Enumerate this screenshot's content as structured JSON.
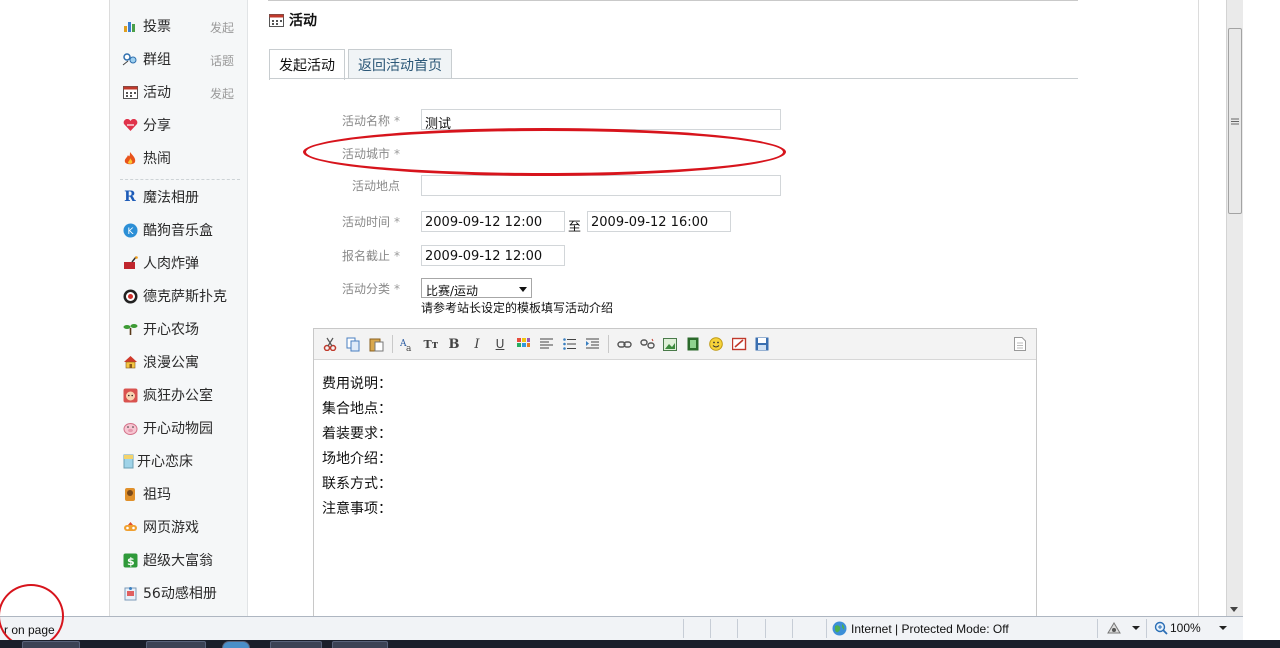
{
  "sidebar": {
    "items": [
      {
        "label": "投票",
        "action": "发起",
        "icon": "poll-icon"
      },
      {
        "label": "群组",
        "action": "话题",
        "icon": "group-icon"
      },
      {
        "label": "活动",
        "action": "发起",
        "icon": "event-icon"
      },
      {
        "label": "分享",
        "action": "",
        "icon": "share-heart-icon"
      },
      {
        "label": "热闹",
        "action": "",
        "icon": "fire-icon"
      },
      {
        "label": "魔法相册",
        "action": "",
        "icon": "magic-album-icon"
      },
      {
        "label": "酷狗音乐盒",
        "action": "",
        "icon": "kugou-music-icon"
      },
      {
        "label": "人肉炸弹",
        "action": "",
        "icon": "bomb-icon"
      },
      {
        "label": "德克萨斯扑克",
        "action": "",
        "icon": "poker-chip-icon"
      },
      {
        "label": "开心农场",
        "action": "",
        "icon": "farm-sprout-icon"
      },
      {
        "label": "浪漫公寓",
        "action": "",
        "icon": "house-icon"
      },
      {
        "label": "疯狂办公室",
        "action": "",
        "icon": "office-face-icon"
      },
      {
        "label": "开心动物园",
        "action": "",
        "icon": "pig-icon"
      },
      {
        "label": "开心恋床",
        "action": "",
        "icon": "bed-icon"
      },
      {
        "label": "祖玛",
        "action": "",
        "icon": "zuma-icon"
      },
      {
        "label": "网页游戏",
        "action": "",
        "icon": "web-game-icon"
      },
      {
        "label": "超级大富翁",
        "action": "",
        "icon": "money-icon"
      },
      {
        "label": "56动感相册",
        "action": "",
        "icon": "photo-album-icon"
      }
    ]
  },
  "page": {
    "title": "活动",
    "tabs": [
      "发起活动",
      "返回活动首页"
    ]
  },
  "form": {
    "name_label": "活动名称",
    "name_value": "测试",
    "city_label": "活动城市",
    "location_label": "活动地点",
    "location_value": "",
    "time_label": "活动时间",
    "time_start": "2009-09-12 12:00",
    "time_to": "至",
    "time_end": "2009-09-12 16:00",
    "deadline_label": "报名截止",
    "deadline_value": "2009-09-12 12:00",
    "category_label": "活动分类",
    "category_value": "比赛/运动",
    "required_mark": "*",
    "hint": "请参考站长设定的模板填写活动介绍"
  },
  "editor": {
    "toolbar_icons": [
      "cut-icon",
      "copy-icon",
      "paste-icon",
      "font-icon",
      "font-size-icon",
      "bold-icon",
      "italic-icon",
      "underline-icon",
      "color-icon",
      "align-icon",
      "list-icon",
      "indent-icon",
      "link-icon",
      "unlink-icon",
      "image-icon",
      "media-icon",
      "smiley-icon",
      "clear-format-icon",
      "save-icon",
      "source-icon"
    ],
    "lines": [
      "费用说明：",
      "集合地点：",
      "着装要求：",
      "场地介绍：",
      "联系方式：",
      "注意事项："
    ]
  },
  "statusbar": {
    "text": "r on page",
    "zone": "Internet | Protected Mode: Off",
    "zoom": "100%"
  },
  "colors": {
    "annotation": "#d7141c",
    "sidebar_bg": "#f5f7f8",
    "tab_link": "#2b5777"
  }
}
